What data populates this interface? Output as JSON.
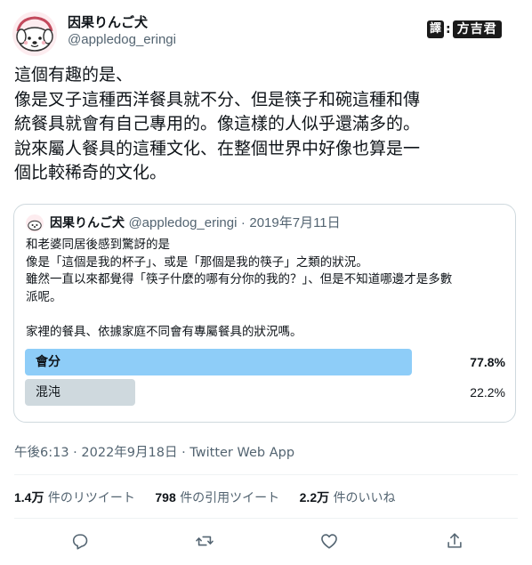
{
  "author": {
    "display_name": "因果りんご犬",
    "handle": "@appledog_eringi"
  },
  "badge": {
    "tag": "譯",
    "colon": ":",
    "name": "方吉君"
  },
  "tweet": {
    "lines": [
      "這個有趣的是、",
      "像是叉子這種西洋餐具就不分、但是筷子和碗這種和傳",
      "統餐具就會有自己專用的。像這樣的人似乎還滿多的。",
      "說來屬人餐具的這種文化、在整個世界中好像也算是一",
      "個比較稀奇的文化。"
    ]
  },
  "quote": {
    "display_name": "因果りんご犬",
    "handle": "@appledog_eringi",
    "separator": "·",
    "date": "2019年7月11日",
    "lines": [
      "和老婆同居後感到驚訝的是",
      "像是「這個是我的杯子」、或是「那個是我的筷子」之類的狀況。",
      "雖然一直以來都覺得「筷子什麼的哪有分你的我的？」、但是不知道哪邊才是多數",
      "派呢。",
      "",
      "家裡的餐具、依據家庭不同會有專屬餐具的狀況嗎。"
    ],
    "poll": [
      {
        "label": "會分",
        "percent_text": "77.8%",
        "share": 0.778,
        "leading": true
      },
      {
        "label": "混沌",
        "percent_text": "22.2%",
        "share": 0.222,
        "leading": false
      }
    ]
  },
  "timestamp": "午後6:13 · 2022年9月18日 · Twitter Web App",
  "stats": {
    "retweets": {
      "count": "1.4万",
      "label": "件のリツイート"
    },
    "quotes": {
      "count": "798",
      "label": "件の引用ツイート"
    },
    "likes": {
      "count": "2.2万",
      "label": "件のいいね"
    }
  },
  "colors": {
    "poll_leading": "#8ecdf8",
    "poll_other": "#cfd9de",
    "secondary_text": "#536471"
  },
  "icons": [
    "reply-icon",
    "retweet-icon",
    "like-icon",
    "share-icon"
  ]
}
